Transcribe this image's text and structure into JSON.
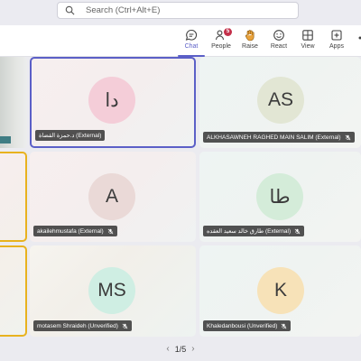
{
  "search": {
    "placeholder": "Search (Ctrl+Alt+E)"
  },
  "toolbar": {
    "items": [
      {
        "label": "Chat",
        "icon": "chat-icon"
      },
      {
        "label": "People",
        "icon": "people-icon",
        "badge": "5"
      },
      {
        "label": "Raise",
        "icon": "raise-hand-icon"
      },
      {
        "label": "React",
        "icon": "react-icon"
      },
      {
        "label": "View",
        "icon": "view-icon"
      },
      {
        "label": "Apps",
        "icon": "apps-icon"
      }
    ]
  },
  "participants": [
    {
      "initials": "دا",
      "name": "د.حمزة القضاة (External)",
      "avatar_bg": "#f4cdd8"
    },
    {
      "initials": "AS",
      "name": "ALKHASAWNEH RAGHED MAIN SALIM (External)",
      "avatar_bg": "#e2e6d4"
    },
    {
      "initials": "A",
      "name": "akailehmustafa (External)",
      "avatar_bg": "#ead9d7"
    },
    {
      "initials": "طا",
      "name": "طارق خالد سعيد العقده (External)",
      "avatar_bg": "#d4ecd9"
    },
    {
      "initials": "MS",
      "name": "motasem Shraideh (Unverified)",
      "avatar_bg": "#cfeee3"
    },
    {
      "initials": "K",
      "name": "Khaledanbousi (Unverified)",
      "avatar_bg": "#f7e2b8"
    }
  ],
  "pager": {
    "text": "1/5"
  },
  "colors": {
    "accent": "#5b5fc7",
    "speaking_frame": "#e8b21e",
    "badge": "#c4314b"
  }
}
